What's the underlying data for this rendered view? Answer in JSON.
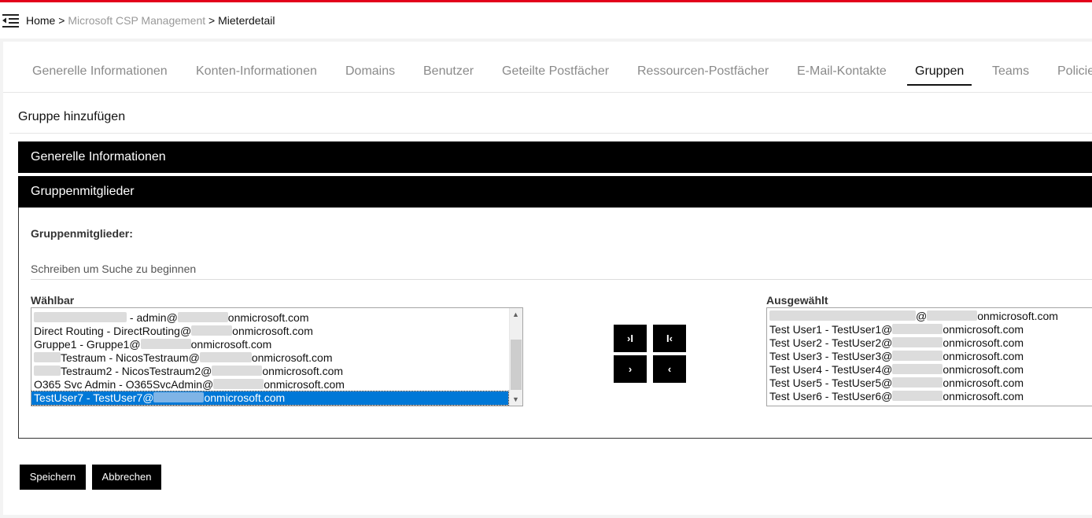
{
  "breadcrumb": {
    "home": "Home",
    "sep1": ">",
    "section": "Microsoft CSP Management",
    "sep2": ">",
    "current": "Mieterdetail"
  },
  "tabs": [
    {
      "label": "Generelle Informationen"
    },
    {
      "label": "Konten-Informationen"
    },
    {
      "label": "Domains"
    },
    {
      "label": "Benutzer"
    },
    {
      "label": "Geteilte Postfächer"
    },
    {
      "label": "Ressourcen-Postfächer"
    },
    {
      "label": "E-Mail-Kontakte"
    },
    {
      "label": "Gruppen",
      "active": true
    },
    {
      "label": "Teams"
    },
    {
      "label": "Policie"
    }
  ],
  "panel": {
    "title": "Gruppe hinzufügen"
  },
  "sections": {
    "general": "Generelle Informationen",
    "members": "Gruppenmitglieder"
  },
  "members": {
    "label": "Gruppenmitglieder:",
    "search_placeholder": "Schreiben um Suche zu beginnen",
    "available_label": "Wählbar",
    "selected_label": "Ausgewählt",
    "available": [
      {
        "name": "",
        "rest": " - admin@",
        "domain": "onmicrosoft.com"
      },
      {
        "name": "Direct Routing - DirectRouting@",
        "rest": "",
        "domain": "onmicrosoft.com"
      },
      {
        "name": "Gruppe1 - Gruppe1@",
        "rest": "",
        "domain": "onmicrosoft.com"
      },
      {
        "name": "",
        "rest": "Testraum - NicosTestraum@",
        "domain": "onmicrosoft.com"
      },
      {
        "name": "",
        "rest": "Testraum2 - NicosTestraum2@",
        "domain": "onmicrosoft.com"
      },
      {
        "name": "O365 Svc Admin - O365SvcAdmin@",
        "rest": "",
        "domain": "onmicrosoft.com"
      },
      {
        "name": "TestUser7 - TestUser7@",
        "rest": "",
        "domain": "onmicrosoft.com",
        "selected": true
      }
    ],
    "selected": [
      {
        "name": "",
        "rest": "@",
        "domain": "onmicrosoft.com"
      },
      {
        "name": "Test User1 - TestUser1@",
        "rest": "",
        "domain": "onmicrosoft.com"
      },
      {
        "name": "Test User2 - TestUser2@",
        "rest": "",
        "domain": "onmicrosoft.com"
      },
      {
        "name": "Test User3 - TestUser3@",
        "rest": "",
        "domain": "onmicrosoft.com"
      },
      {
        "name": "Test User4 - TestUser4@",
        "rest": "",
        "domain": "onmicrosoft.com"
      },
      {
        "name": "Test User5 - TestUser5@",
        "rest": "",
        "domain": "onmicrosoft.com"
      },
      {
        "name": "Test User6 - TestUser6@",
        "rest": "",
        "domain": "onmicrosoft.com"
      }
    ],
    "move_buttons": {
      "add_all": "›I",
      "remove_all": "I‹",
      "add": "›",
      "remove": "‹"
    }
  },
  "actions": {
    "save": "Speichern",
    "cancel": "Abbrechen"
  },
  "colors": {
    "accent_red": "#e3001b",
    "selection_blue": "#0078d7",
    "black": "#000000"
  }
}
